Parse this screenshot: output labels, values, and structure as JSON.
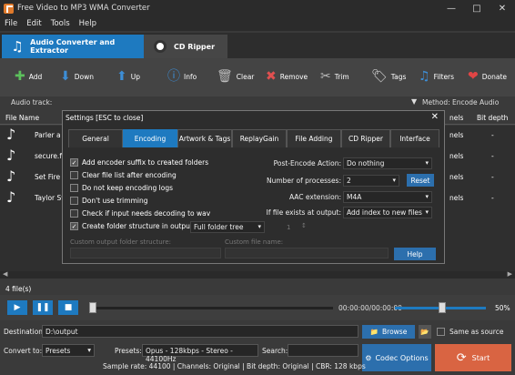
{
  "window": {
    "title": "Free Video to MP3 WMA Converter"
  },
  "menu": [
    "File",
    "Edit",
    "Tools",
    "Help"
  ],
  "main_tabs": {
    "audio": "Audio Converter and Extractor",
    "cd": "CD Ripper"
  },
  "toolbar": {
    "add": "Add",
    "down": "Down",
    "up": "Up",
    "info": "Info",
    "clear": "Clear",
    "remove": "Remove",
    "trim": "Trim",
    "tags": "Tags",
    "filters": "Filters",
    "donate": "Donate"
  },
  "audio_track": {
    "label": "Audio track:",
    "method": "Method:   Encode Audio"
  },
  "columns": {
    "file_name": "File Name",
    "channels": "nels",
    "bit_depth": "Bit depth"
  },
  "files": [
    {
      "name": "Parler a n",
      "channels": "nels",
      "bit_depth": "-"
    },
    {
      "name": "secure.fli",
      "channels": "nels",
      "bit_depth": "-"
    },
    {
      "name": "Set Fire t",
      "channels": "nels",
      "bit_depth": "-"
    },
    {
      "name": "Taylor Sw",
      "channels": "nels",
      "bit_depth": "-"
    }
  ],
  "file_count": "4 file(s)",
  "player": {
    "time": "00:00:00/00:00:00",
    "volume_text": "50%",
    "position": 0,
    "volume": 0.5
  },
  "destination": {
    "label": "Destination:",
    "value": "D:\\output",
    "browse": "Browse",
    "same_as_source": "Same as source"
  },
  "convert": {
    "label": "Convert to:",
    "value": "Presets",
    "presets_label": "Presets:",
    "presets_value": "Opus - 128kbps - Stereo - 44100Hz",
    "search_label": "Search:"
  },
  "codec_options": "Codec Options",
  "start": "Start",
  "info_line": "Sample rate: 44100 | Channels: Original | Bit depth: Original | CBR: 128 kbps",
  "dialog": {
    "title": "Settings [ESC to close]",
    "tabs": [
      "General",
      "Encoding",
      "Artwork & Tags",
      "ReplayGain",
      "File Adding",
      "CD Ripper",
      "Interface"
    ],
    "options": [
      {
        "label": "Add encoder suffix to created folders",
        "checked": true
      },
      {
        "label": "Clear file list after encoding",
        "checked": false
      },
      {
        "label": "Do not keep encoding logs",
        "checked": false
      },
      {
        "label": "Don't use trimming",
        "checked": false
      },
      {
        "label": "Check if input needs decoding to wav",
        "checked": false
      },
      {
        "label": "Create folder structure in output",
        "checked": true
      }
    ],
    "folder_tree": "Full folder tree",
    "folder_tree_num": "1",
    "custom_output_label": "Custom output folder structure:",
    "custom_file_label": "Custom file name:",
    "post_encode_label": "Post-Encode Action:",
    "post_encode_value": "Do nothing",
    "processes_label": "Number of processes:",
    "processes_value": "2",
    "reset": "Reset",
    "aac_label": "AAC extension:",
    "aac_value": "M4A",
    "exists_label": "If file exists at output:",
    "exists_value": "Add index to new files",
    "help": "Help"
  },
  "colors": {
    "accent": "#1e7ac0",
    "start": "#d96442",
    "background": "#3a3a3a"
  }
}
